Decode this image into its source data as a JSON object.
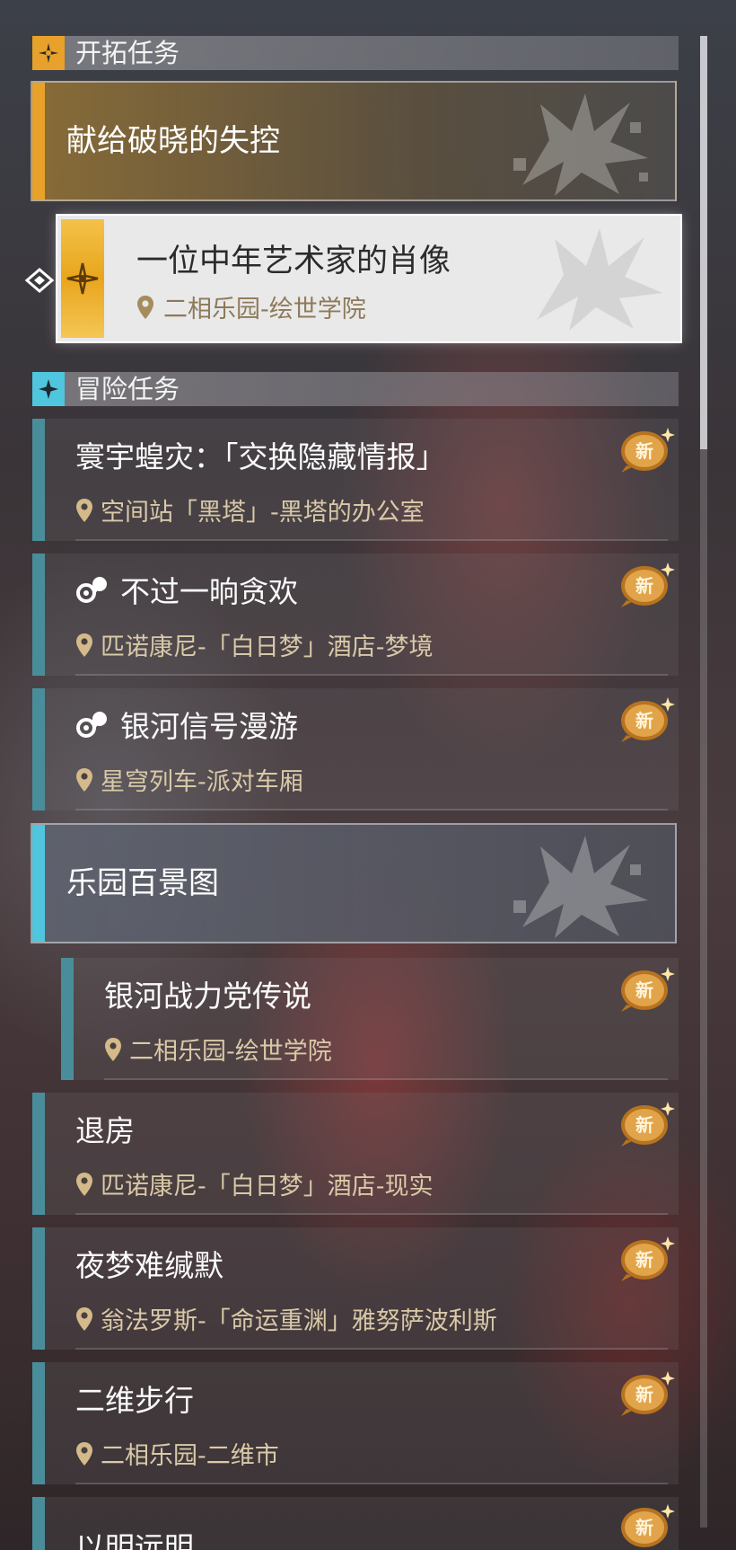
{
  "sections": {
    "trailblaze": {
      "title": "开拓任务"
    },
    "adventure": {
      "title": "冒险任务"
    }
  },
  "trailblaze_group": {
    "title": "献给破晓的失控"
  },
  "active_quest": {
    "title": "一位中年艺术家的肖像",
    "location": "二相乐园-绘世学院"
  },
  "adventure_quests_a": [
    {
      "title": "寰宇蝗灾：「交换隐藏情报」",
      "location": "空间站「黑塔」-黑塔的办公室",
      "badge": "新"
    },
    {
      "title": "不过一晌贪欢",
      "location": "匹诺康尼-「白日梦」酒店-梦境",
      "badge": "新"
    },
    {
      "title": "银河信号漫游",
      "location": "星穹列车-派对车厢",
      "badge": "新"
    }
  ],
  "adventure_group": {
    "title": "乐园百景图"
  },
  "nested_quest": {
    "title": "银河战力党传说",
    "location": "二相乐园-绘世学院",
    "badge": "新"
  },
  "adventure_quests_b": [
    {
      "title": "退房",
      "location": "匹诺康尼-「白日梦」酒店-现实",
      "badge": "新"
    },
    {
      "title": "夜梦难缄默",
      "location": "翁法罗斯-「命运重渊」雅努萨波利斯",
      "badge": "新"
    },
    {
      "title": "二维步行",
      "location": "二相乐园-二维市",
      "badge": "新"
    },
    {
      "title": "以明远明",
      "location": "",
      "badge": "新"
    }
  ],
  "colors": {
    "trailblaze_accent": "#e8a12a",
    "adventure_accent": "#4fc6dd",
    "quest_bar": "#4a8d9a",
    "location_text": "#d9c9a8"
  },
  "icons": {
    "trailblaze": "trailblaze-emblem-icon",
    "adventure": "adventure-star-icon",
    "location": "location-pin-icon",
    "companion": "companion-quest-icon",
    "new_badge": "new-badge-icon"
  }
}
